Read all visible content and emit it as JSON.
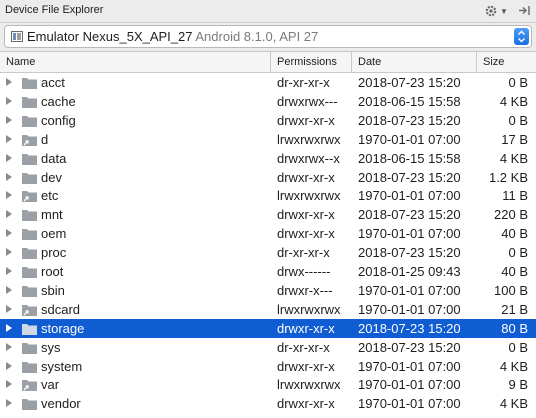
{
  "panel": {
    "title": "Device File Explorer"
  },
  "device": {
    "name": "Emulator Nexus_5X_API_27",
    "meta": "Android 8.1.0, API 27"
  },
  "columns": {
    "name": "Name",
    "permissions": "Permissions",
    "date": "Date",
    "size": "Size"
  },
  "colors": {
    "selection": "#0f5cd3",
    "folder": "#9aa0a6"
  },
  "files": [
    {
      "name": "acct",
      "permissions": "dr-xr-xr-x",
      "date": "2018-07-23 15:20",
      "size": "0 B",
      "link": false,
      "selected": false
    },
    {
      "name": "cache",
      "permissions": "drwxrwx---",
      "date": "2018-06-15 15:58",
      "size": "4 KB",
      "link": false,
      "selected": false
    },
    {
      "name": "config",
      "permissions": "drwxr-xr-x",
      "date": "2018-07-23 15:20",
      "size": "0 B",
      "link": false,
      "selected": false
    },
    {
      "name": "d",
      "permissions": "lrwxrwxrwx",
      "date": "1970-01-01 07:00",
      "size": "17 B",
      "link": true,
      "selected": false
    },
    {
      "name": "data",
      "permissions": "drwxrwx--x",
      "date": "2018-06-15 15:58",
      "size": "4 KB",
      "link": false,
      "selected": false
    },
    {
      "name": "dev",
      "permissions": "drwxr-xr-x",
      "date": "2018-07-23 15:20",
      "size": "1.2 KB",
      "link": false,
      "selected": false
    },
    {
      "name": "etc",
      "permissions": "lrwxrwxrwx",
      "date": "1970-01-01 07:00",
      "size": "11 B",
      "link": true,
      "selected": false
    },
    {
      "name": "mnt",
      "permissions": "drwxr-xr-x",
      "date": "2018-07-23 15:20",
      "size": "220 B",
      "link": false,
      "selected": false
    },
    {
      "name": "oem",
      "permissions": "drwxr-xr-x",
      "date": "1970-01-01 07:00",
      "size": "40 B",
      "link": false,
      "selected": false
    },
    {
      "name": "proc",
      "permissions": "dr-xr-xr-x",
      "date": "2018-07-23 15:20",
      "size": "0 B",
      "link": false,
      "selected": false
    },
    {
      "name": "root",
      "permissions": "drwx------",
      "date": "2018-01-25 09:43",
      "size": "40 B",
      "link": false,
      "selected": false
    },
    {
      "name": "sbin",
      "permissions": "drwxr-x---",
      "date": "1970-01-01 07:00",
      "size": "100 B",
      "link": false,
      "selected": false
    },
    {
      "name": "sdcard",
      "permissions": "lrwxrwxrwx",
      "date": "1970-01-01 07:00",
      "size": "21 B",
      "link": true,
      "selected": false
    },
    {
      "name": "storage",
      "permissions": "drwxr-xr-x",
      "date": "2018-07-23 15:20",
      "size": "80 B",
      "link": false,
      "selected": true
    },
    {
      "name": "sys",
      "permissions": "dr-xr-xr-x",
      "date": "2018-07-23 15:20",
      "size": "0 B",
      "link": false,
      "selected": false
    },
    {
      "name": "system",
      "permissions": "drwxr-xr-x",
      "date": "1970-01-01 07:00",
      "size": "4 KB",
      "link": false,
      "selected": false
    },
    {
      "name": "var",
      "permissions": "lrwxrwxrwx",
      "date": "1970-01-01 07:00",
      "size": "9 B",
      "link": true,
      "selected": false
    },
    {
      "name": "vendor",
      "permissions": "drwxr-xr-x",
      "date": "1970-01-01 07:00",
      "size": "4 KB",
      "link": false,
      "selected": false
    }
  ]
}
